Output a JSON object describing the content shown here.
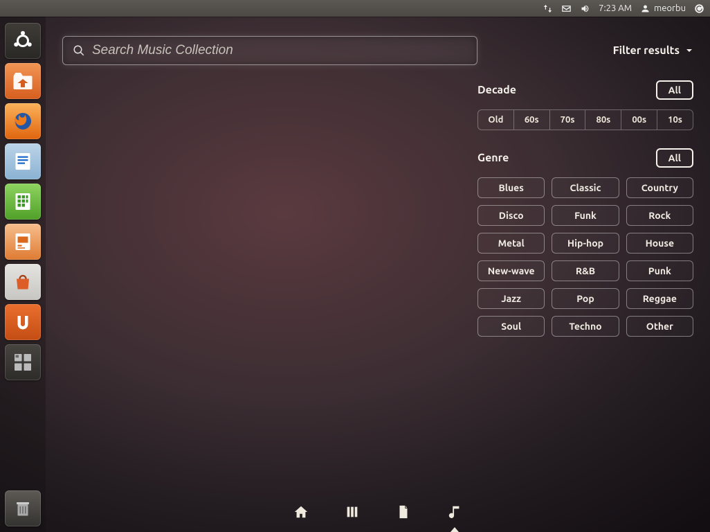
{
  "top_panel": {
    "time": "7:23 AM",
    "user": "meorbu"
  },
  "launcher": {
    "items": [
      {
        "name": "dash",
        "icon": "ubuntu"
      },
      {
        "name": "files",
        "icon": "home-folder"
      },
      {
        "name": "firefox",
        "icon": "firefox"
      },
      {
        "name": "writer",
        "icon": "writer"
      },
      {
        "name": "calc",
        "icon": "calc"
      },
      {
        "name": "impress",
        "icon": "impress"
      },
      {
        "name": "software-center",
        "icon": "bag"
      },
      {
        "name": "ubuntu-one",
        "icon": "u-one"
      },
      {
        "name": "workspace-switcher",
        "icon": "workspaces"
      }
    ],
    "trash": "trash"
  },
  "dash": {
    "search_placeholder": "Search Music Collection",
    "filter_label": "Filter results"
  },
  "filters": {
    "decade": {
      "title": "Decade",
      "all": "All",
      "options": [
        "Old",
        "60s",
        "70s",
        "80s",
        "00s",
        "10s"
      ]
    },
    "genre": {
      "title": "Genre",
      "all": "All",
      "options": [
        "Blues",
        "Classic",
        "Country",
        "Disco",
        "Funk",
        "Rock",
        "Metal",
        "Hip-hop",
        "House",
        "New-wave",
        "R&B",
        "Punk",
        "Jazz",
        "Pop",
        "Reggae",
        "Soul",
        "Techno",
        "Other"
      ]
    }
  },
  "lenses": [
    {
      "name": "home",
      "active": false
    },
    {
      "name": "applications",
      "active": false
    },
    {
      "name": "files",
      "active": false
    },
    {
      "name": "music",
      "active": true
    }
  ]
}
